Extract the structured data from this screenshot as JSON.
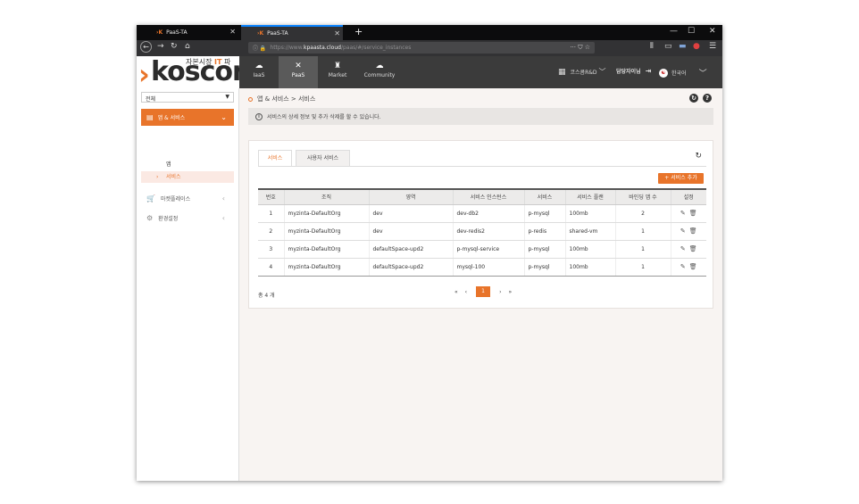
{
  "browser": {
    "tabs": [
      {
        "title": "PaaS-TA",
        "close": "✕"
      },
      {
        "title": "PaaS-TA",
        "close": "✕"
      }
    ],
    "new_tab": "+",
    "window_controls": {
      "minimize": "—",
      "maximize": "☐",
      "close": "✕"
    },
    "url": {
      "prefix": "https://www.",
      "host": "kpaasta.cloud",
      "path": "/paas/#/service_instances",
      "more": "···"
    }
  },
  "logo": {
    "subtitle_main": "자본시장 ",
    "subtitle_it": "IT",
    "subtitle_rest": " 파",
    "chevron": "›",
    "word": "koscom"
  },
  "header": {
    "nav": [
      {
        "label": "IaaS",
        "icon": "cloud-icon"
      },
      {
        "label": "PaaS",
        "icon": "tools-icon"
      },
      {
        "label": "Market",
        "icon": "market-icon"
      },
      {
        "label": "Community",
        "icon": "chat-icon"
      }
    ],
    "org_label": "코스콤R&D",
    "user_label": "담당자이님",
    "language": "한국어"
  },
  "sidebar": {
    "select_value": "전체",
    "active_menu": "앱 & 서비스",
    "submenu": [
      {
        "label": "앱"
      },
      {
        "label": "서비스"
      }
    ],
    "items": [
      {
        "label": "마켓플레이스"
      },
      {
        "label": "환경설정"
      }
    ]
  },
  "main": {
    "breadcrumb": "앱 & 서비스 > 서비스",
    "notice": "서비스의 상세 정보 및 추가 삭제를 할 수 있습니다.",
    "tabs": [
      {
        "label": "서비스"
      },
      {
        "label": "사용자 서비스"
      }
    ],
    "add_button": "+ 서비스 추가",
    "table": {
      "headers": [
        "번호",
        "조직",
        "영역",
        "서비스 인스턴스",
        "서비스",
        "서비스 플랜",
        "바인딩 앱 수",
        "설정"
      ],
      "rows": [
        [
          "1",
          "myzinta-DefaultOrg",
          "dev",
          "dev-db2",
          "p-mysql",
          "100mb",
          "2"
        ],
        [
          "2",
          "myzinta-DefaultOrg",
          "dev",
          "dev-redis2",
          "p-redis",
          "shared-vm",
          "1"
        ],
        [
          "3",
          "myzinta-DefaultOrg",
          "defaultSpace-upd2",
          "p-mysql-service",
          "p-mysql",
          "100mb",
          "1"
        ],
        [
          "4",
          "myzinta-DefaultOrg",
          "defaultSpace-upd2",
          "mysql-100",
          "p-mysql",
          "100mb",
          "1"
        ]
      ]
    },
    "total": "총 4 개",
    "pagination": {
      "first": "«",
      "prev": "‹",
      "current": "1",
      "next": "›",
      "last": "»"
    }
  }
}
